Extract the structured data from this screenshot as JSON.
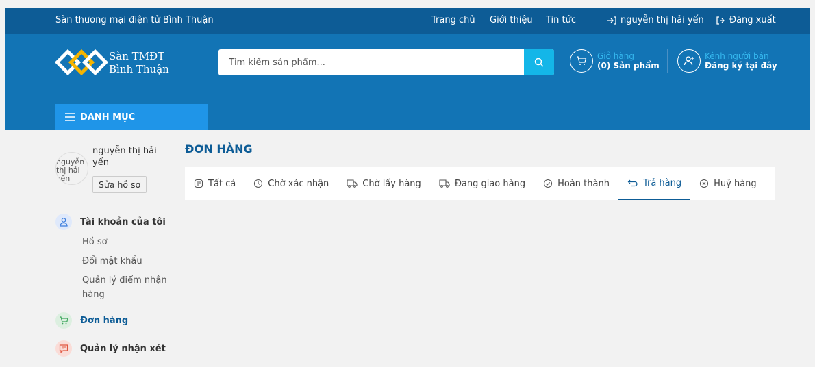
{
  "topbar": {
    "site_name": "Sàn thương mại điện tử Bình Thuận",
    "nav": [
      "Trang chủ",
      "Giới thiệu",
      "Tin tức"
    ],
    "user": "nguyễn thị hải yến",
    "logout": "Đăng xuất"
  },
  "header": {
    "logo_line1": "Sàn TMĐT",
    "logo_line2": "Bình Thuận",
    "search_placeholder": "Tìm kiếm sản phẩm...",
    "cart_label": "Giỏ hàng",
    "cart_count": "(0) Sản phẩm",
    "seller_label": "Kênh người bán",
    "seller_action": "Đăng ký tại đây",
    "menu_label": "DANH MỤC"
  },
  "sidebar": {
    "avatar_alt": "nguyễn thị hải yến",
    "user_name": "nguyễn thị hải yến",
    "edit_profile": "Sửa hồ sơ",
    "account_title": "Tài khoản của tôi",
    "account_items": [
      "Hồ sơ",
      "Đổi mật khẩu",
      "Quản lý điểm nhận hàng"
    ],
    "orders": "Đơn hàng",
    "reviews": "Quản lý nhận xét"
  },
  "main": {
    "title": "ĐƠN HÀNG",
    "tabs": [
      "Tất cả",
      "Chờ xác nhận",
      "Chờ lấy hàng",
      "Đang giao hàng",
      "Hoàn thành",
      "Trả hàng",
      "Huỷ hàng"
    ],
    "active_tab": "Trả hàng"
  },
  "colors": {
    "topbar": "#0d5c96",
    "header": "#1274b5",
    "accent": "#14b6e8",
    "menu_tab": "#1f95e8"
  }
}
